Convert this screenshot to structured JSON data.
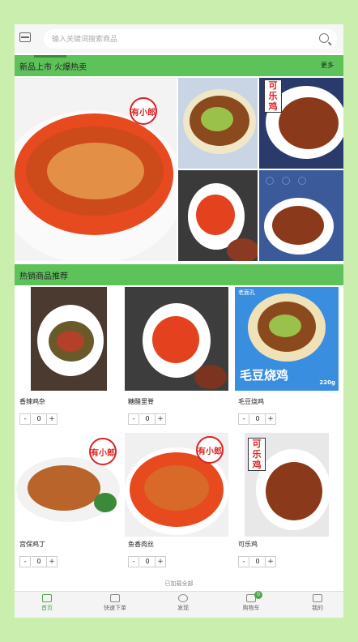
{
  "search": {
    "placeholder": "输入关键词搜索商品"
  },
  "new_section": {
    "title": "新品上市 火爆热卖",
    "more": "更多"
  },
  "hot_section": {
    "title": "热销商品推荐"
  },
  "brand": {
    "logo_text": "有小郎",
    "cola_text": "可乐鸡"
  },
  "promo_label": "毛豆烧鸡",
  "promo_weight": "220g",
  "promo_corner": "老面孔",
  "products": [
    {
      "name": "香辣鸡杂",
      "qty": "0"
    },
    {
      "name": "糖醋里脊",
      "qty": "0"
    },
    {
      "name": "毛豆烧鸡",
      "qty": "0"
    },
    {
      "name": "宫保鸡丁",
      "qty": "0"
    },
    {
      "name": "鱼香肉丝",
      "qty": "0"
    },
    {
      "name": "可乐鸡",
      "qty": "0"
    }
  ],
  "stepper": {
    "minus": "-",
    "plus": "+"
  },
  "footer_note": "已加载全部",
  "tabs": [
    {
      "label": "首页"
    },
    {
      "label": "快速下单"
    },
    {
      "label": "发现"
    },
    {
      "label": "购物车"
    },
    {
      "label": "我的"
    }
  ],
  "cart_count": "0",
  "colors": {
    "accent": "#5ec25a",
    "background": "#c9eeae"
  }
}
